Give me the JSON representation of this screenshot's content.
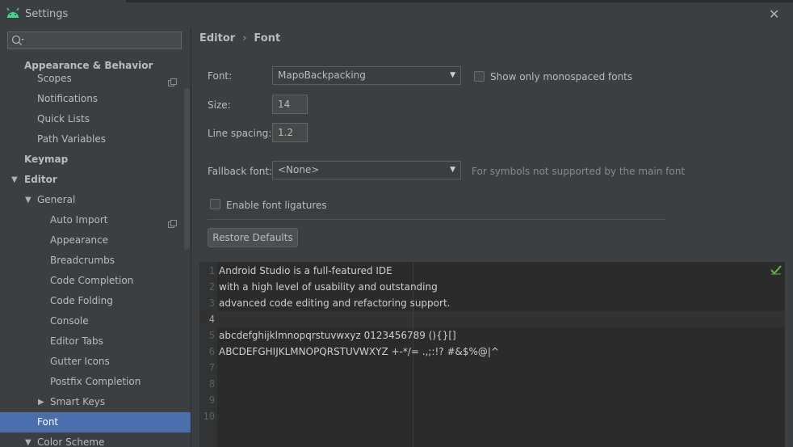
{
  "window": {
    "title": "Settings"
  },
  "search": {
    "placeholder": ""
  },
  "sidebar": {
    "items": [
      {
        "label": "Appearance & Behavior"
      },
      {
        "label": "Scopes"
      },
      {
        "label": "Notifications"
      },
      {
        "label": "Quick Lists"
      },
      {
        "label": "Path Variables"
      },
      {
        "label": "Keymap"
      },
      {
        "label": "Editor"
      },
      {
        "label": "General"
      },
      {
        "label": "Auto Import"
      },
      {
        "label": "Appearance"
      },
      {
        "label": "Breadcrumbs"
      },
      {
        "label": "Code Completion"
      },
      {
        "label": "Code Folding"
      },
      {
        "label": "Console"
      },
      {
        "label": "Editor Tabs"
      },
      {
        "label": "Gutter Icons"
      },
      {
        "label": "Postfix Completion"
      },
      {
        "label": "Smart Keys"
      },
      {
        "label": "Font"
      },
      {
        "label": "Color Scheme"
      }
    ]
  },
  "breadcrumb": {
    "parent": "Editor",
    "current": "Font"
  },
  "form": {
    "font_label": "Font:",
    "font_value": "MapoBackpacking",
    "mono_label": "Show only monospaced fonts",
    "size_label": "Size:",
    "size_value": "14",
    "spacing_label": "Line spacing:",
    "spacing_value": "1.2",
    "fallback_label": "Fallback font:",
    "fallback_value": "<None>",
    "fallback_hint": "For symbols not supported by the main font",
    "ligatures_label": "Enable font ligatures",
    "restore_label": "Restore Defaults"
  },
  "preview": {
    "lines": [
      {
        "num": "1",
        "text": "Android Studio is a full-featured IDE"
      },
      {
        "num": "2",
        "text": "with a high level of usability and outstanding"
      },
      {
        "num": "3",
        "text": "advanced code editing and refactoring support."
      },
      {
        "num": "4",
        "text": ""
      },
      {
        "num": "5",
        "text": "abcdefghijklmnopqrstuvwxyz 0123456789 (){}[]"
      },
      {
        "num": "6",
        "text": "ABCDEFGHIJKLMNOPQRSTUVWXYZ +-*/= .,;:!? #&$%@|^"
      },
      {
        "num": "7",
        "text": ""
      },
      {
        "num": "8",
        "text": ""
      },
      {
        "num": "9",
        "text": ""
      },
      {
        "num": "10",
        "text": ""
      }
    ]
  },
  "colors": {
    "accent": "#4b6eaf",
    "android_green": "#3ddc84",
    "check_green": "#62b543"
  }
}
